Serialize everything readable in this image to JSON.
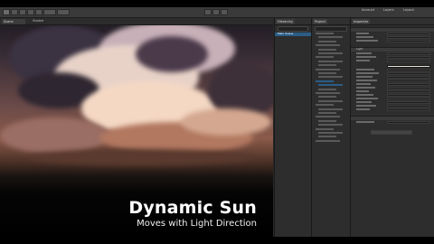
{
  "toolbar": {
    "play_icon": "play-icon",
    "pause_icon": "pause-icon",
    "step_icon": "step-icon",
    "layout_label": "Layout",
    "layers_label": "Layers",
    "account_label": "Account"
  },
  "scene": {
    "tab_label": "Scene",
    "shading_label": "Shaded"
  },
  "caption": {
    "title": "Dynamic Sun",
    "subtitle": "Moves with Light Direction"
  },
  "hierarchy": {
    "tab_label": "Hierarchy",
    "root": "Main Scene"
  },
  "project": {
    "tab_label": "Project"
  },
  "inspector": {
    "tab_label": "Inspector",
    "component": "Light"
  },
  "colors": {
    "selection": "#2c5d87",
    "panel_bg": "#2d2d2d",
    "caption_text": "#ffffff"
  }
}
